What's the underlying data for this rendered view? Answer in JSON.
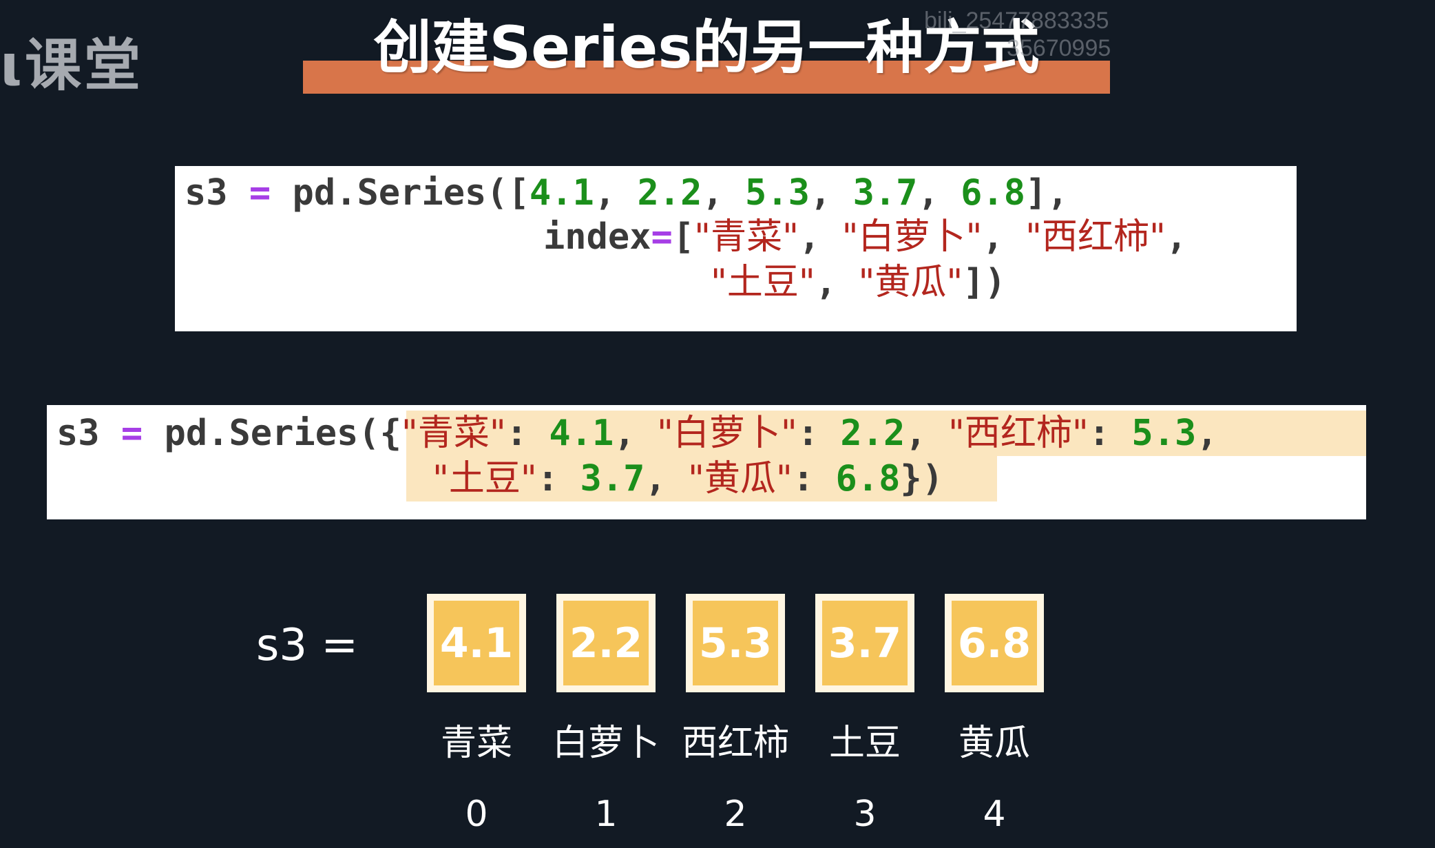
{
  "logo": {
    "text": "课堂"
  },
  "watermark": {
    "line1": "bili_25477883335",
    "line2": "35670995"
  },
  "header": {
    "title": "创建Series的另一种方式",
    "bar_color": "#d8754a"
  },
  "code1": {
    "line1": [
      {
        "t": "s3 ",
        "c": "default"
      },
      {
        "t": "=",
        "c": "op"
      },
      {
        "t": " pd.Series([",
        "c": "default"
      },
      {
        "t": "4.1",
        "c": "num"
      },
      {
        "t": ", ",
        "c": "default"
      },
      {
        "t": "2.2",
        "c": "num"
      },
      {
        "t": ", ",
        "c": "default"
      },
      {
        "t": "5.3",
        "c": "num"
      },
      {
        "t": ", ",
        "c": "default"
      },
      {
        "t": "3.7",
        "c": "num"
      },
      {
        "t": ", ",
        "c": "default"
      },
      {
        "t": "6.8",
        "c": "num"
      },
      {
        "t": "],",
        "c": "default"
      }
    ],
    "line2": [
      {
        "t": "index",
        "c": "default"
      },
      {
        "t": "=",
        "c": "op"
      },
      {
        "t": "[",
        "c": "default"
      },
      {
        "t": "\"青菜\"",
        "c": "str"
      },
      {
        "t": ", ",
        "c": "default"
      },
      {
        "t": "\"白萝卜\"",
        "c": "str"
      },
      {
        "t": ", ",
        "c": "default"
      },
      {
        "t": "\"西红柿\"",
        "c": "str"
      },
      {
        "t": ",",
        "c": "default"
      }
    ],
    "line3": [
      {
        "t": "\"土豆\"",
        "c": "str"
      },
      {
        "t": ", ",
        "c": "default"
      },
      {
        "t": "\"黄瓜\"",
        "c": "str"
      },
      {
        "t": "])",
        "c": "default"
      }
    ]
  },
  "code2": {
    "line1": [
      {
        "t": "s3 ",
        "c": "default"
      },
      {
        "t": "=",
        "c": "op"
      },
      {
        "t": " pd.Series(",
        "c": "default"
      },
      {
        "t": "{",
        "c": "default"
      },
      {
        "t": "\"青菜\"",
        "c": "str"
      },
      {
        "t": ": ",
        "c": "default"
      },
      {
        "t": "4.1",
        "c": "num"
      },
      {
        "t": ", ",
        "c": "default"
      },
      {
        "t": "\"白萝卜\"",
        "c": "str"
      },
      {
        "t": ": ",
        "c": "default"
      },
      {
        "t": "2.2",
        "c": "num"
      },
      {
        "t": ", ",
        "c": "default"
      },
      {
        "t": "\"西红柿\"",
        "c": "str"
      },
      {
        "t": ": ",
        "c": "default"
      },
      {
        "t": "5.3",
        "c": "num"
      },
      {
        "t": ",",
        "c": "default"
      }
    ],
    "line2": [
      {
        "t": "\"土豆\"",
        "c": "str"
      },
      {
        "t": ": ",
        "c": "default"
      },
      {
        "t": "3.7",
        "c": "num"
      },
      {
        "t": ", ",
        "c": "default"
      },
      {
        "t": "\"黄瓜\"",
        "c": "str"
      },
      {
        "t": ": ",
        "c": "default"
      },
      {
        "t": "6.8",
        "c": "num"
      },
      {
        "t": "}",
        "c": "default"
      },
      {
        "t": ")",
        "c": "default"
      }
    ]
  },
  "colors": {
    "default": "#3a3a3a",
    "op": "#a63ee6",
    "num": "#1b8f1b",
    "str": "#b3261e",
    "highlight": "#fbe6bf",
    "cell_fill": "#f6c55a",
    "background": "#121a24"
  },
  "diagram": {
    "label": "s3  =",
    "cells": [
      {
        "value": "4.1",
        "label": "青菜",
        "pos": "0"
      },
      {
        "value": "2.2",
        "label": "白萝卜",
        "pos": "1"
      },
      {
        "value": "5.3",
        "label": "西红柿",
        "pos": "2"
      },
      {
        "value": "3.7",
        "label": "土豆",
        "pos": "3"
      },
      {
        "value": "6.8",
        "label": "黄瓜",
        "pos": "4"
      }
    ]
  }
}
